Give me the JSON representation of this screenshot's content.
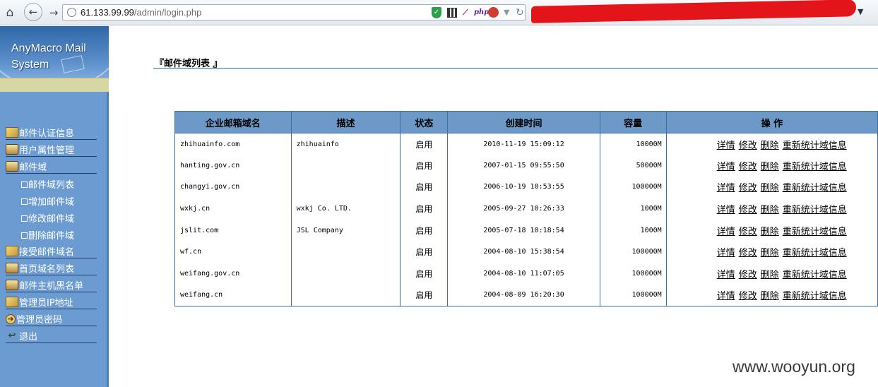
{
  "browser": {
    "url_host": "61.133.99.99",
    "url_path": "/admin/login.php",
    "ext_php": "php"
  },
  "logo": {
    "line1": "AnyMacro Mail",
    "line2": "System"
  },
  "sidebar": {
    "items": [
      {
        "label": "邮件认证信息",
        "icon": "document-icon"
      },
      {
        "label": "用户属性管理",
        "icon": "book-icon"
      },
      {
        "label": "邮件域",
        "icon": "book-icon"
      },
      {
        "label": "接受邮件域名",
        "icon": "document-icon"
      },
      {
        "label": "首页域名列表",
        "icon": "book-icon"
      },
      {
        "label": "邮件主机黑名单",
        "icon": "book-icon"
      },
      {
        "label": "管理员IP地址",
        "icon": "document-icon"
      },
      {
        "label": "管理员密码",
        "icon": "arrow-icon"
      },
      {
        "label": "退出",
        "icon": "exit-icon"
      }
    ],
    "subitems": [
      "邮件域列表",
      "增加邮件域",
      "修改邮件域",
      "删除邮件域"
    ]
  },
  "main": {
    "title": "『邮件域列表 』",
    "headers": [
      "企业邮箱域名",
      "描述",
      "状态",
      "创建时间",
      "容量",
      "操 作"
    ],
    "actions": [
      "详情",
      "修改",
      "删除",
      "重新统计域信息"
    ],
    "rows": [
      {
        "name": "zhihuainfo.com",
        "desc": "zhihuainfo",
        "status": "启用",
        "created": "2010-11-19 15:09:12",
        "capacity": "10000M"
      },
      {
        "name": "hanting.gov.cn",
        "desc": "",
        "status": "启用",
        "created": "2007-01-15 09:55:50",
        "capacity": "50000M"
      },
      {
        "name": "changyi.gov.cn",
        "desc": "",
        "status": "启用",
        "created": "2006-10-19 10:53:55",
        "capacity": "100000M"
      },
      {
        "name": "wxkj.cn",
        "desc": "wxkj Co. LTD.",
        "status": "启用",
        "created": "2005-09-27 10:26:33",
        "capacity": "1000M"
      },
      {
        "name": "jslit.com",
        "desc": "JSL Company",
        "status": "启用",
        "created": "2005-07-18 10:18:54",
        "capacity": "1000M"
      },
      {
        "name": "wf.cn",
        "desc": "",
        "status": "启用",
        "created": "2004-08-10 15:38:54",
        "capacity": "100000M"
      },
      {
        "name": "weifang.gov.cn",
        "desc": "",
        "status": "启用",
        "created": "2004-08-10 11:07:05",
        "capacity": "100000M"
      },
      {
        "name": "weifang.cn",
        "desc": "",
        "status": "启用",
        "created": "2004-08-09 16:20:30",
        "capacity": "100000M"
      }
    ]
  },
  "watermark": "www.wooyun.org"
}
